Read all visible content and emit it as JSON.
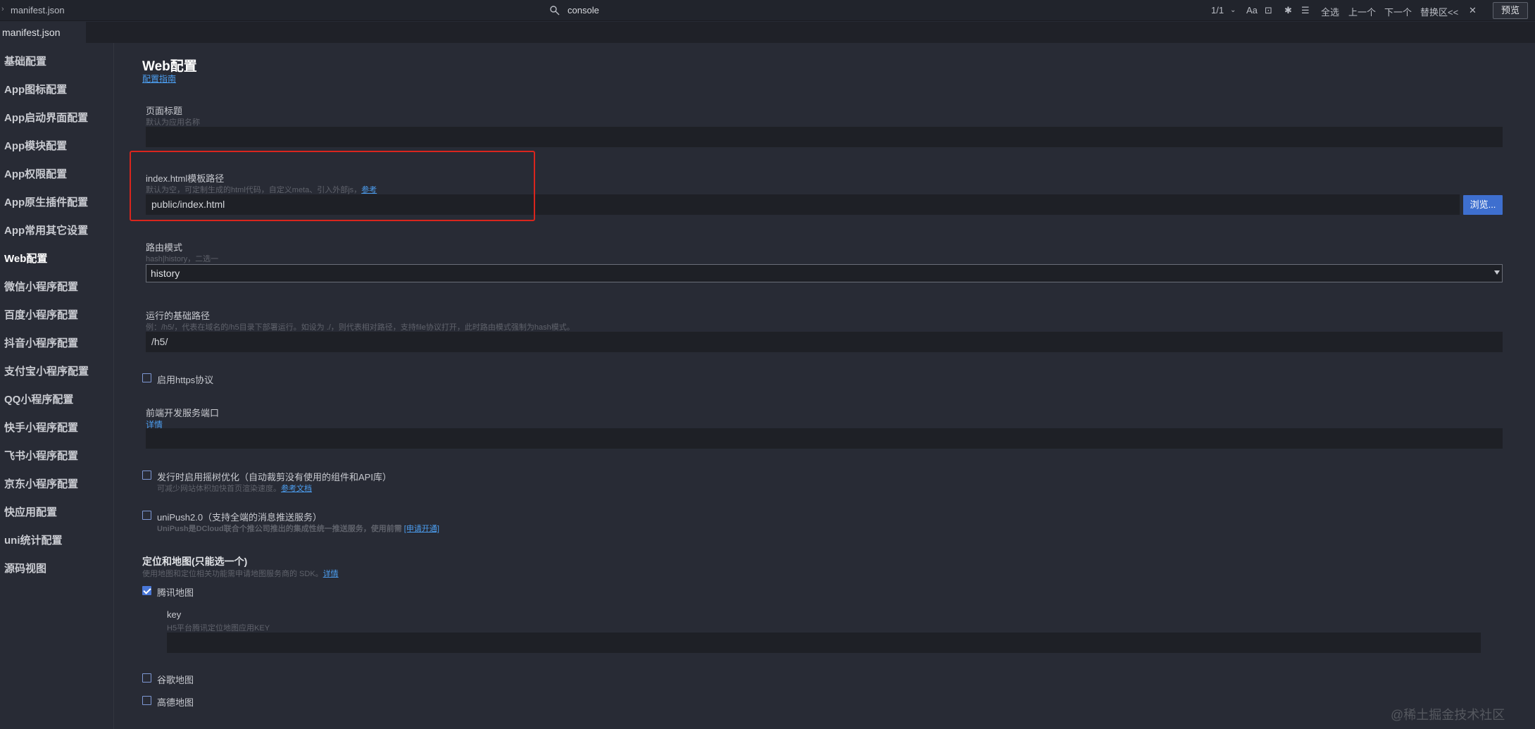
{
  "topbar": {
    "file_title": "manifest.json",
    "console_label": "console",
    "match_count": "1/1",
    "case_label": "Aa",
    "select_all_label": "全选",
    "prev_label": "上一个",
    "next_label": "下一个",
    "replace_toggle_label": "替换区<<",
    "close_symbol": "✕",
    "preview_label": "预览"
  },
  "tab": {
    "label": "manifest.json"
  },
  "sidebar": {
    "items": [
      {
        "label": "基础配置"
      },
      {
        "label": "App图标配置"
      },
      {
        "label": "App启动界面配置"
      },
      {
        "label": "App模块配置"
      },
      {
        "label": "App权限配置"
      },
      {
        "label": "App原生插件配置"
      },
      {
        "label": "App常用其它设置"
      },
      {
        "label": "Web配置"
      },
      {
        "label": "微信小程序配置"
      },
      {
        "label": "百度小程序配置"
      },
      {
        "label": "抖音小程序配置"
      },
      {
        "label": "支付宝小程序配置"
      },
      {
        "label": "QQ小程序配置"
      },
      {
        "label": "快手小程序配置"
      },
      {
        "label": "飞书小程序配置"
      },
      {
        "label": "京东小程序配置"
      },
      {
        "label": "快应用配置"
      },
      {
        "label": "uni统计配置"
      },
      {
        "label": "源码视图"
      }
    ],
    "active_index": 7
  },
  "main": {
    "title": "Web配置",
    "guide_link": "配置指南",
    "page_title": {
      "label": "页面标题",
      "hint": "默认为应用名称",
      "value": ""
    },
    "template_path": {
      "label": "index.html模板路径",
      "hint": "默认为空，可定制生成的html代码，自定义meta、引入外部js，",
      "ref_link": "参考",
      "value": "public/index.html",
      "browse_label": "浏览..."
    },
    "router_mode": {
      "label": "路由模式",
      "hint": "hash|history，二选一",
      "value": "history"
    },
    "base_path": {
      "label": "运行的基础路径",
      "hint": "例：/h5/，代表在域名的/h5目录下部署运行。如设为 ./，则代表相对路径，支持file协议打开，此时路由模式强制为hash模式。",
      "value": "/h5/"
    },
    "https": {
      "label": "启用https协议",
      "checked": false
    },
    "dev_port": {
      "label": "前端开发服务端口",
      "detail_link": "详情",
      "value": ""
    },
    "tree_shaking": {
      "label": "发行时启用摇树优化（自动裁剪没有使用的组件和API库）",
      "hint": "可减少网站体积加快首页渲染速度。",
      "ref_link": "参考文档",
      "checked": false
    },
    "unipush": {
      "label": "uniPush2.0（支持全端的消息推送服务）",
      "hint": "UniPush是DCloud联合个推公司推出的集成性统一推送服务，使用前需",
      "apply_link": "[申请开通]",
      "checked": false
    },
    "maps": {
      "title": "定位和地图(只能选一个)",
      "hint": "使用地图和定位相关功能需申请地图服务商的 SDK。",
      "detail_link": "详情",
      "tencent": {
        "label": "腾讯地图",
        "checked": true
      },
      "key": {
        "label": "key",
        "hint": "H5平台腾讯定位地图应用KEY",
        "value": ""
      },
      "google": {
        "label": "谷歌地图",
        "checked": false
      },
      "amap": {
        "label": "高德地图",
        "checked": false
      }
    }
  },
  "watermark": "@稀土掘金技术社区",
  "colors": {
    "background": "#282b35",
    "input_bg": "#1e2026",
    "accent_blue": "#3e6fcf",
    "link_blue": "#4c9ef0",
    "highlight_red": "#d9251d"
  }
}
